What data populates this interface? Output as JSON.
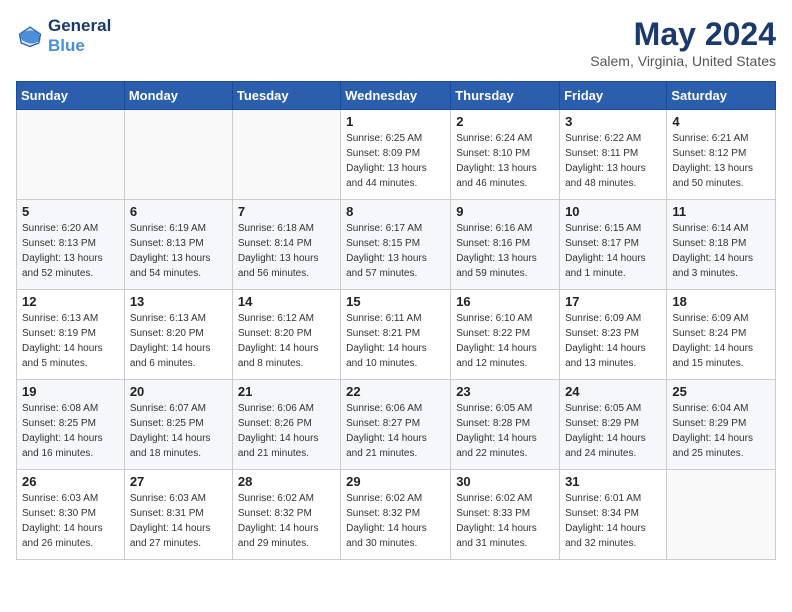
{
  "header": {
    "logo_line1": "General",
    "logo_line2": "Blue",
    "title": "May 2024",
    "location": "Salem, Virginia, United States"
  },
  "weekdays": [
    "Sunday",
    "Monday",
    "Tuesday",
    "Wednesday",
    "Thursday",
    "Friday",
    "Saturday"
  ],
  "weeks": [
    [
      {
        "day": "",
        "info": ""
      },
      {
        "day": "",
        "info": ""
      },
      {
        "day": "",
        "info": ""
      },
      {
        "day": "1",
        "info": "Sunrise: 6:25 AM\nSunset: 8:09 PM\nDaylight: 13 hours\nand 44 minutes."
      },
      {
        "day": "2",
        "info": "Sunrise: 6:24 AM\nSunset: 8:10 PM\nDaylight: 13 hours\nand 46 minutes."
      },
      {
        "day": "3",
        "info": "Sunrise: 6:22 AM\nSunset: 8:11 PM\nDaylight: 13 hours\nand 48 minutes."
      },
      {
        "day": "4",
        "info": "Sunrise: 6:21 AM\nSunset: 8:12 PM\nDaylight: 13 hours\nand 50 minutes."
      }
    ],
    [
      {
        "day": "5",
        "info": "Sunrise: 6:20 AM\nSunset: 8:13 PM\nDaylight: 13 hours\nand 52 minutes."
      },
      {
        "day": "6",
        "info": "Sunrise: 6:19 AM\nSunset: 8:13 PM\nDaylight: 13 hours\nand 54 minutes."
      },
      {
        "day": "7",
        "info": "Sunrise: 6:18 AM\nSunset: 8:14 PM\nDaylight: 13 hours\nand 56 minutes."
      },
      {
        "day": "8",
        "info": "Sunrise: 6:17 AM\nSunset: 8:15 PM\nDaylight: 13 hours\nand 57 minutes."
      },
      {
        "day": "9",
        "info": "Sunrise: 6:16 AM\nSunset: 8:16 PM\nDaylight: 13 hours\nand 59 minutes."
      },
      {
        "day": "10",
        "info": "Sunrise: 6:15 AM\nSunset: 8:17 PM\nDaylight: 14 hours\nand 1 minute."
      },
      {
        "day": "11",
        "info": "Sunrise: 6:14 AM\nSunset: 8:18 PM\nDaylight: 14 hours\nand 3 minutes."
      }
    ],
    [
      {
        "day": "12",
        "info": "Sunrise: 6:13 AM\nSunset: 8:19 PM\nDaylight: 14 hours\nand 5 minutes."
      },
      {
        "day": "13",
        "info": "Sunrise: 6:13 AM\nSunset: 8:20 PM\nDaylight: 14 hours\nand 6 minutes."
      },
      {
        "day": "14",
        "info": "Sunrise: 6:12 AM\nSunset: 8:20 PM\nDaylight: 14 hours\nand 8 minutes."
      },
      {
        "day": "15",
        "info": "Sunrise: 6:11 AM\nSunset: 8:21 PM\nDaylight: 14 hours\nand 10 minutes."
      },
      {
        "day": "16",
        "info": "Sunrise: 6:10 AM\nSunset: 8:22 PM\nDaylight: 14 hours\nand 12 minutes."
      },
      {
        "day": "17",
        "info": "Sunrise: 6:09 AM\nSunset: 8:23 PM\nDaylight: 14 hours\nand 13 minutes."
      },
      {
        "day": "18",
        "info": "Sunrise: 6:09 AM\nSunset: 8:24 PM\nDaylight: 14 hours\nand 15 minutes."
      }
    ],
    [
      {
        "day": "19",
        "info": "Sunrise: 6:08 AM\nSunset: 8:25 PM\nDaylight: 14 hours\nand 16 minutes."
      },
      {
        "day": "20",
        "info": "Sunrise: 6:07 AM\nSunset: 8:25 PM\nDaylight: 14 hours\nand 18 minutes."
      },
      {
        "day": "21",
        "info": "Sunrise: 6:06 AM\nSunset: 8:26 PM\nDaylight: 14 hours\nand 21 minutes."
      },
      {
        "day": "22",
        "info": "Sunrise: 6:06 AM\nSunset: 8:27 PM\nDaylight: 14 hours\nand 21 minutes."
      },
      {
        "day": "23",
        "info": "Sunrise: 6:05 AM\nSunset: 8:28 PM\nDaylight: 14 hours\nand 22 minutes."
      },
      {
        "day": "24",
        "info": "Sunrise: 6:05 AM\nSunset: 8:29 PM\nDaylight: 14 hours\nand 24 minutes."
      },
      {
        "day": "25",
        "info": "Sunrise: 6:04 AM\nSunset: 8:29 PM\nDaylight: 14 hours\nand 25 minutes."
      }
    ],
    [
      {
        "day": "26",
        "info": "Sunrise: 6:03 AM\nSunset: 8:30 PM\nDaylight: 14 hours\nand 26 minutes."
      },
      {
        "day": "27",
        "info": "Sunrise: 6:03 AM\nSunset: 8:31 PM\nDaylight: 14 hours\nand 27 minutes."
      },
      {
        "day": "28",
        "info": "Sunrise: 6:02 AM\nSunset: 8:32 PM\nDaylight: 14 hours\nand 29 minutes."
      },
      {
        "day": "29",
        "info": "Sunrise: 6:02 AM\nSunset: 8:32 PM\nDaylight: 14 hours\nand 30 minutes."
      },
      {
        "day": "30",
        "info": "Sunrise: 6:02 AM\nSunset: 8:33 PM\nDaylight: 14 hours\nand 31 minutes."
      },
      {
        "day": "31",
        "info": "Sunrise: 6:01 AM\nSunset: 8:34 PM\nDaylight: 14 hours\nand 32 minutes."
      },
      {
        "day": "",
        "info": ""
      }
    ]
  ]
}
